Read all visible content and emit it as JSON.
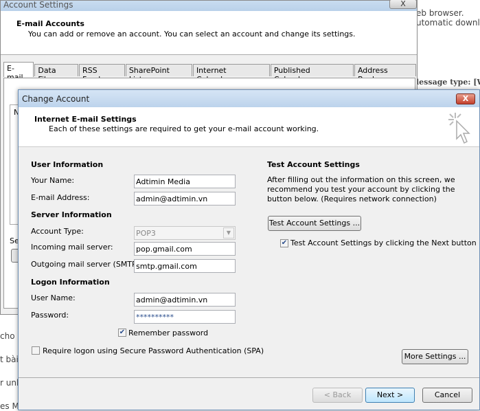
{
  "background": {
    "texts": [
      "eb browser.",
      "utomatic downloa",
      "lessage type: [WNC",
      "cho g",
      "t bài",
      "r unlo",
      "es M"
    ]
  },
  "account_settings": {
    "title": "Account Settings",
    "close_label": "X",
    "header_title": "E-mail Accounts",
    "header_desc": "You can add or remove an account. You can select an account and change its settings.",
    "tabs": [
      "E-mail",
      "Data Files",
      "RSS Feeds",
      "SharePoint Lists",
      "Internet Calendars",
      "Published Calendars",
      "Address Books"
    ],
    "partial_labels": {
      "n": "N",
      "se": "Se"
    }
  },
  "change_account": {
    "title": "Change Account",
    "close_label": "X",
    "header_title": "Internet E-mail Settings",
    "header_desc": "Each of these settings are required to get your e-mail account working.",
    "user_info": {
      "heading": "User Information",
      "name_label": "Your Name:",
      "name_value": "Adtimin Media",
      "email_label": "E-mail Address:",
      "email_value": "admin@adtimin.vn"
    },
    "server_info": {
      "heading": "Server Information",
      "type_label": "Account Type:",
      "type_value": "POP3",
      "incoming_label": "Incoming mail server:",
      "incoming_value": "pop.gmail.com",
      "outgoing_label": "Outgoing mail server (SMTP):",
      "outgoing_value": "smtp.gmail.com"
    },
    "logon_info": {
      "heading": "Logon Information",
      "user_label": "User Name:",
      "user_value": "admin@adtimin.vn",
      "password_label": "Password:",
      "password_value": "**********",
      "remember_label": "Remember password",
      "remember_checked": true,
      "spa_label": "Require logon using Secure Password Authentication (SPA)",
      "spa_checked": false
    },
    "test": {
      "heading": "Test Account Settings",
      "desc": "After filling out the information on this screen, we recommend you test your account by clicking the button below. (Requires network connection)",
      "button": "Test Account Settings ...",
      "next_label": "Test Account Settings by clicking the Next button",
      "next_checked": true
    },
    "more_settings": "More Settings ...",
    "back": "< Back",
    "next": "Next >",
    "cancel": "Cancel"
  }
}
